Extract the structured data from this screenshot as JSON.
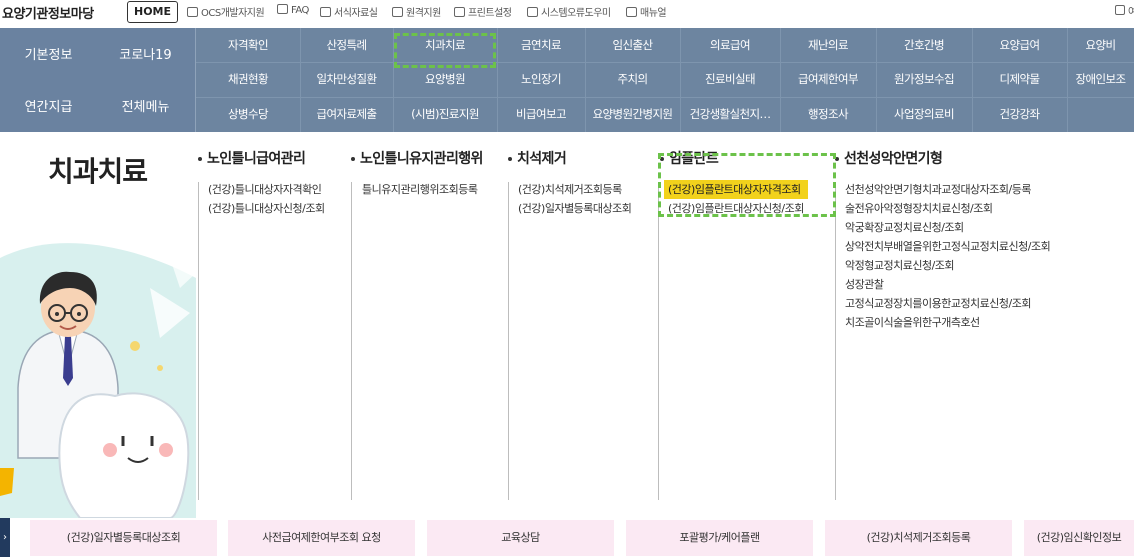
{
  "header": {
    "site_title": "요양기관정보마당",
    "home_label": "HOME",
    "utils": [
      {
        "label": "OCS개발자지원",
        "icon": "calendar-icon"
      },
      {
        "label": "FAQ",
        "icon": "chat-icon"
      },
      {
        "label": "서식자료실",
        "icon": "grid-icon"
      },
      {
        "label": "원격지원",
        "icon": "monitor-icon"
      },
      {
        "label": "프린트설정",
        "icon": "printer-icon"
      },
      {
        "label": "시스템오류도우미",
        "icon": "printer-icon"
      },
      {
        "label": "매뉴얼",
        "icon": "document-icon"
      }
    ],
    "right_edge": "여"
  },
  "nav": {
    "left": [
      "기본정보",
      "코로나19",
      "연간지급",
      "전체메뉴"
    ],
    "rows": [
      [
        "자격확인",
        "산정특례",
        "치과치료",
        "금연치료",
        "임신출산",
        "의료급여",
        "재난의료",
        "간호간병",
        "요양급여",
        "요양비"
      ],
      [
        "채권현황",
        "일차만성질환",
        "요양병원",
        "노인장기",
        "주치의",
        "진료비실태",
        "급여제한여부",
        "원가정보수집",
        "디제약물",
        "장애인보조"
      ],
      [
        "상병수당",
        "급여자료제출",
        "(시범)진료지원",
        "비급여보고",
        "요양병원간병지원",
        "건강생활실천지…",
        "행정조사",
        "사업장의료비",
        "건강강좌",
        ""
      ]
    ]
  },
  "content": {
    "page_title": "치과치료",
    "columns": [
      {
        "title": "노인틀니급여관리",
        "links": [
          "(건강)틀니대상자자격확인",
          "(건강)틀니대상자신청/조회"
        ]
      },
      {
        "title": "노인틀니유지관리행위",
        "links": [
          "틀니유지관리행위조회등록"
        ]
      },
      {
        "title": "치석제거",
        "links": [
          "(건강)치석제거조회등록",
          "(건강)일자별등록대상조회"
        ]
      },
      {
        "title": "임플란트",
        "links": [
          "(건강)임플란트대상자자격조회",
          "(건강)임플란트대상자신청/조회"
        ]
      },
      {
        "title": "선천성악안면기형",
        "links": [
          "선천성악안면기형치과교정대상자조회/등록",
          "술전유아악정형장치치료신청/조회",
          "악궁확장교정치료신청/조회",
          "상악전치부배열을위한고정식교정치료신청/조회",
          "악정형교정치료신청/조회",
          "성장관찰",
          "고정식교정장치를이용한교정치료신청/조회",
          "치조골이식술을위한구개측호선"
        ]
      }
    ],
    "highlighted_link": "(건강)임플란트대상자자격조회"
  },
  "quick_links": [
    "(건강)일자별등록대상조회",
    "사전급여제한여부조회 요청",
    "교육상담",
    "포괄평가/케어플랜",
    "(건강)치석제거조회등록",
    "(건강)임신확인정보"
  ],
  "colors": {
    "nav_bg": "#6d85a0",
    "highlight": "#f2d21c",
    "dashed_box": "#6cc24a",
    "quick_bg": "#fbe9f3"
  }
}
